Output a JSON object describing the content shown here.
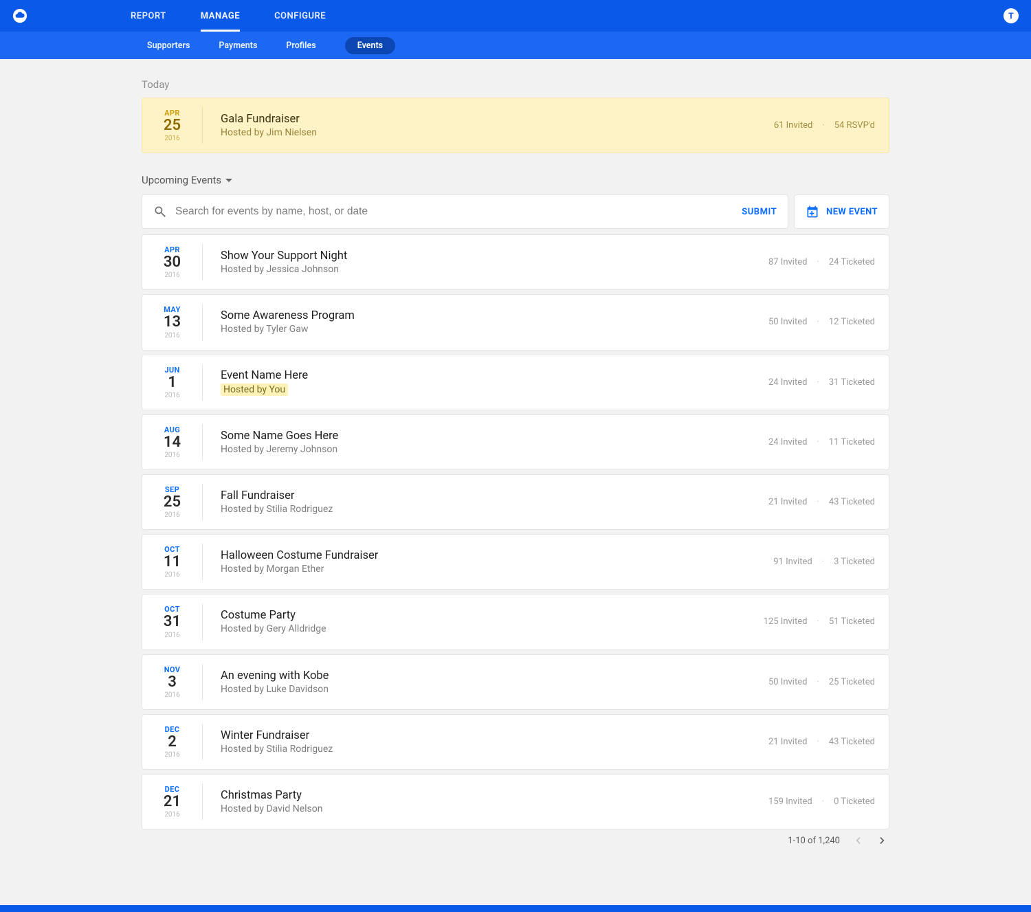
{
  "header": {
    "primary_nav": [
      "REPORT",
      "MANAGE",
      "CONFIGURE"
    ],
    "primary_active_index": 1,
    "secondary_nav": [
      "Supporters",
      "Payments",
      "Profiles",
      "Events"
    ],
    "secondary_active_index": 3,
    "avatar_initial": "T"
  },
  "today_label": "Today",
  "today_event": {
    "month": "APR",
    "day": "25",
    "year": "2016",
    "title": "Gala Fundraiser",
    "host": "Hosted by Jim Nielsen",
    "invited": "61 Invited",
    "secondary": "54 RSVP'd"
  },
  "filter_label": "Upcoming Events",
  "search": {
    "placeholder": "Search for events by name, host, or date",
    "submit_label": "SUBMIT"
  },
  "new_event_label": "NEW EVENT",
  "events": [
    {
      "month": "APR",
      "day": "30",
      "year": "2016",
      "title": "Show Your Support Night",
      "host": "Hosted by Jessica Johnson",
      "invited": "87 Invited",
      "secondary": "24 Ticketed",
      "you": false
    },
    {
      "month": "MAY",
      "day": "13",
      "year": "2016",
      "title": "Some Awareness Program",
      "host": "Hosted by Tyler Gaw",
      "invited": "50 Invited",
      "secondary": "12 Ticketed",
      "you": false
    },
    {
      "month": "JUN",
      "day": "1",
      "year": "2016",
      "title": "Event Name Here",
      "host": "Hosted by You",
      "invited": "24 Invited",
      "secondary": "31 Ticketed",
      "you": true
    },
    {
      "month": "AUG",
      "day": "14",
      "year": "2016",
      "title": "Some Name Goes Here",
      "host": "Hosted by Jeremy Johnson",
      "invited": "24 Invited",
      "secondary": "11 Ticketed",
      "you": false
    },
    {
      "month": "SEP",
      "day": "25",
      "year": "2016",
      "title": "Fall Fundraiser",
      "host": "Hosted by Stilia Rodriguez",
      "invited": "21 Invited",
      "secondary": "43 Ticketed",
      "you": false
    },
    {
      "month": "OCT",
      "day": "11",
      "year": "2016",
      "title": "Halloween Costume Fundraiser",
      "host": "Hosted by Morgan Ether",
      "invited": "91 Invited",
      "secondary": "3 Ticketed",
      "you": false
    },
    {
      "month": "OCT",
      "day": "31",
      "year": "2016",
      "title": "Costume Party",
      "host": "Hosted by Gery Alldridge",
      "invited": "125 Invited",
      "secondary": "51 Ticketed",
      "you": false
    },
    {
      "month": "NOV",
      "day": "3",
      "year": "2016",
      "title": "An evening with Kobe",
      "host": "Hosted by Luke Davidson",
      "invited": "50 Invited",
      "secondary": "25 Ticketed",
      "you": false
    },
    {
      "month": "DEC",
      "day": "2",
      "year": "2016",
      "title": "Winter Fundraiser",
      "host": "Hosted by Stilia Rodriguez",
      "invited": "21 Invited",
      "secondary": "43 Ticketed",
      "you": false
    },
    {
      "month": "DEC",
      "day": "21",
      "year": "2016",
      "title": "Christmas Party",
      "host": "Hosted by David Nelson",
      "invited": "159 Invited",
      "secondary": "0 Ticketed",
      "you": false
    }
  ],
  "pagination": {
    "range": "1-10 of 1,240"
  }
}
